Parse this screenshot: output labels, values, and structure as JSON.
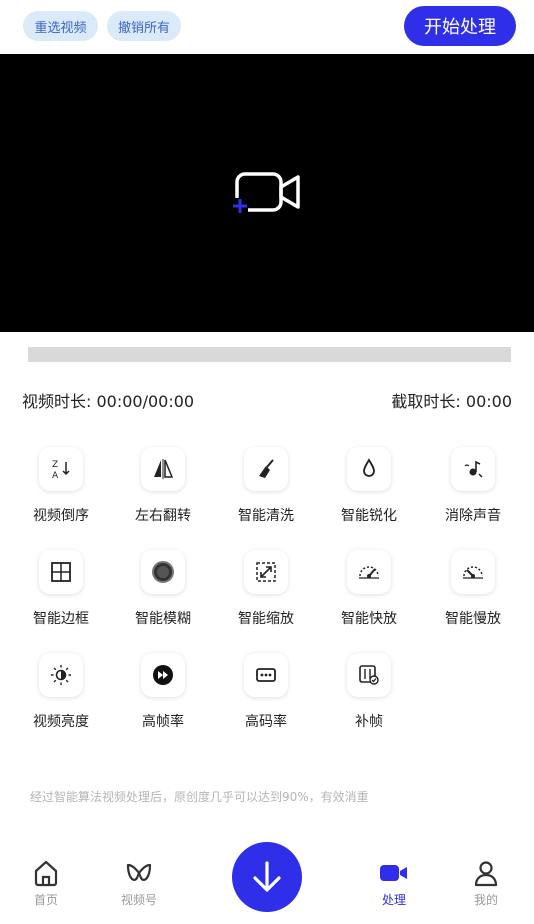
{
  "header": {
    "reselect_label": "重选视频",
    "undo_label": "撤销所有",
    "start_label": "开始处理"
  },
  "player": {
    "duration_label": "视频时长: 00:00/00:00",
    "clip_label": "截取时长: 00:00"
  },
  "tools": [
    {
      "label": "视频倒序",
      "icon": "sort-reverse-icon"
    },
    {
      "label": "左右翻转",
      "icon": "flip-horizontal-icon"
    },
    {
      "label": "智能清洗",
      "icon": "broom-icon"
    },
    {
      "label": "智能锐化",
      "icon": "drop-icon"
    },
    {
      "label": "消除声音",
      "icon": "music-mute-icon"
    },
    {
      "label": "智能边框",
      "icon": "grid-frame-icon"
    },
    {
      "label": "智能模糊",
      "icon": "blur-circle-icon"
    },
    {
      "label": "智能缩放",
      "icon": "zoom-expand-icon"
    },
    {
      "label": "智能快放",
      "icon": "fast-speed-icon"
    },
    {
      "label": "智能慢放",
      "icon": "slow-speed-icon"
    },
    {
      "label": "视频亮度",
      "icon": "brightness-icon"
    },
    {
      "label": "高帧率",
      "icon": "fast-forward-icon"
    },
    {
      "label": "高码率",
      "icon": "bitrate-icon"
    },
    {
      "label": "补帧",
      "icon": "frame-fill-icon"
    }
  ],
  "note": "经过智能算法视频处理后，原创度几乎可以达到90%，有效消重",
  "tabbar": {
    "home": "首页",
    "channel": "视频号",
    "process": "处理",
    "mine": "我的"
  },
  "colors": {
    "accent": "#2f2fea",
    "pill_bg": "#dbeaf8",
    "pill_text": "#3d63c8"
  }
}
